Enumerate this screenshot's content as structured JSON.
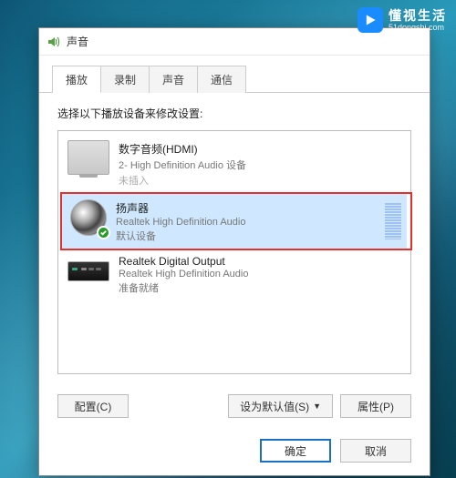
{
  "watermark": {
    "title": "懂视生活",
    "sub": "51dongshi.com"
  },
  "dialog": {
    "title": "声音",
    "tabs": [
      "播放",
      "录制",
      "声音",
      "通信"
    ],
    "active_tab": 0,
    "instruction": "选择以下播放设备来修改设置:"
  },
  "devices": [
    {
      "name": "数字音频(HDMI)",
      "desc": "2- High Definition Audio 设备",
      "status": "未插入",
      "icon": "monitor",
      "selected": false,
      "default": false,
      "status_dim": true
    },
    {
      "name": "扬声器",
      "desc": "Realtek High Definition Audio",
      "status": "默认设备",
      "icon": "speaker",
      "selected": true,
      "default": true,
      "highlight": true
    },
    {
      "name": "Realtek Digital Output",
      "desc": "Realtek High Definition Audio",
      "status": "准备就绪",
      "icon": "receiver",
      "selected": false,
      "default": false
    }
  ],
  "buttons": {
    "configure": "配置(C)",
    "set_default": "设为默认值(S)",
    "properties": "属性(P)",
    "ok": "确定",
    "cancel": "取消"
  }
}
